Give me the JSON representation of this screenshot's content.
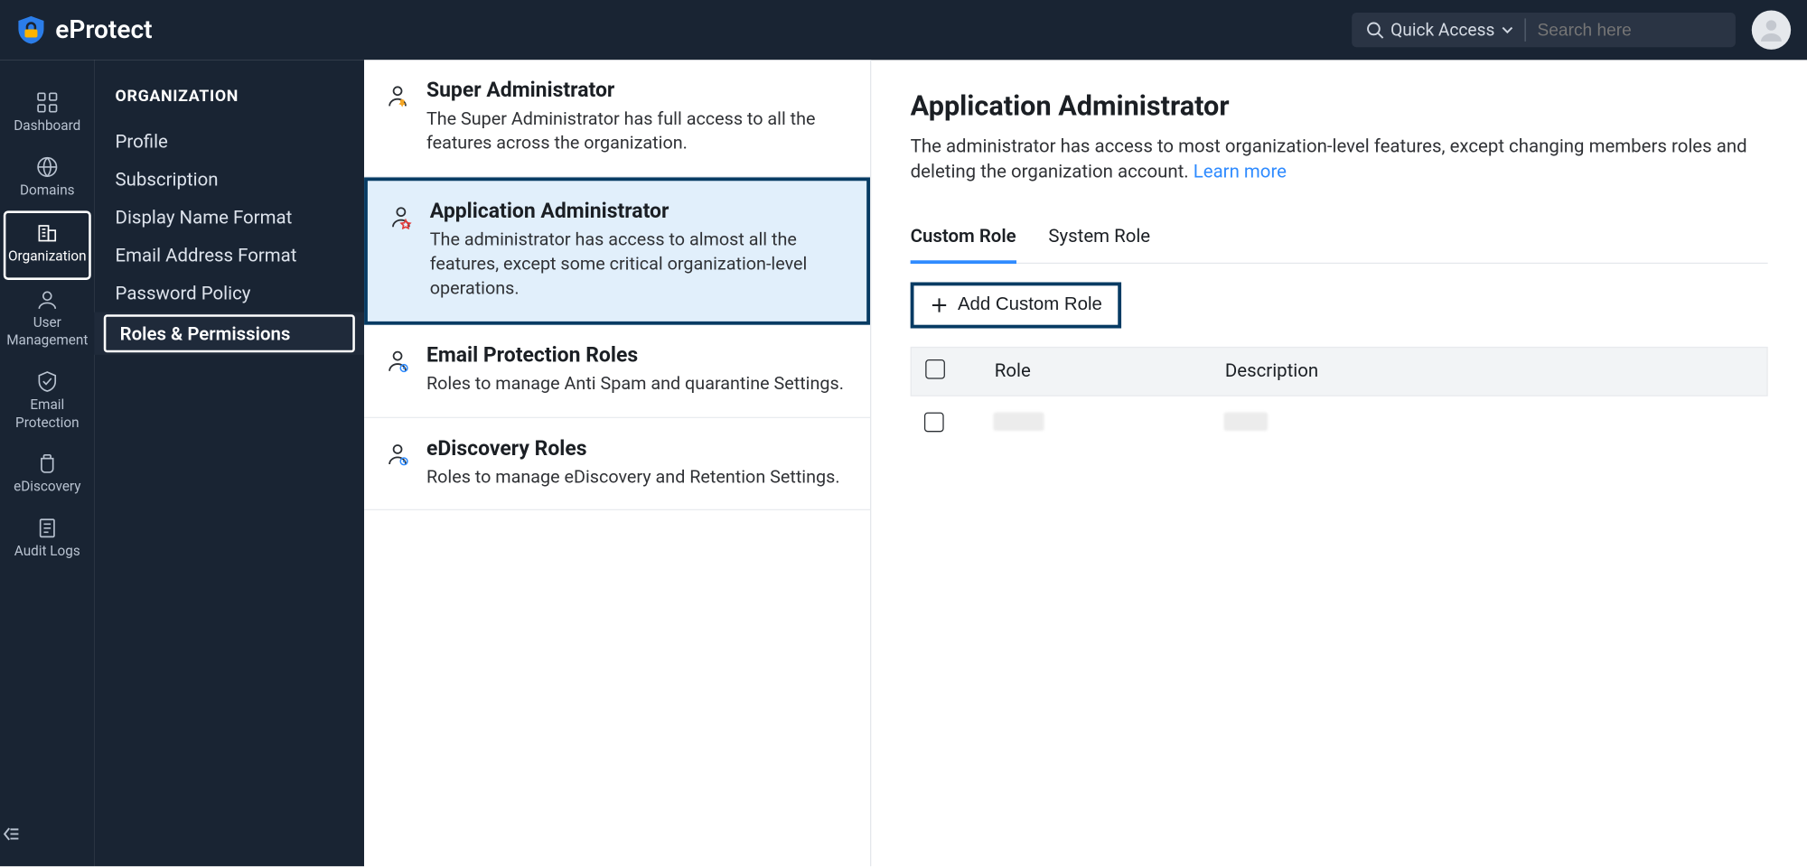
{
  "header": {
    "brand": "eProtect",
    "quick_access_label": "Quick Access",
    "search_placeholder": "Search here"
  },
  "nav": {
    "items": [
      {
        "label": "Dashboard"
      },
      {
        "label": "Domains"
      },
      {
        "label": "Organization"
      },
      {
        "label": "User Management"
      },
      {
        "label": "Email Protection"
      },
      {
        "label": "eDiscovery"
      },
      {
        "label": "Audit Logs"
      }
    ]
  },
  "subnav": {
    "title": "ORGANIZATION",
    "items": [
      {
        "label": "Profile"
      },
      {
        "label": "Subscription"
      },
      {
        "label": "Display Name Format"
      },
      {
        "label": "Email Address Format"
      },
      {
        "label": "Password Policy"
      },
      {
        "label": "Roles & Permissions"
      }
    ]
  },
  "roles_list": [
    {
      "title": "Super Administrator",
      "desc": "The Super Administrator has full access to all the features across the organization."
    },
    {
      "title": "Application Administrator",
      "desc": "The administrator has access to almost all the features, except some critical organization-level operations."
    },
    {
      "title": "Email Protection Roles",
      "desc": "Roles to manage Anti Spam and quarantine Settings."
    },
    {
      "title": "eDiscovery Roles",
      "desc": "Roles to manage eDiscovery and Retention Settings."
    }
  ],
  "details": {
    "title": "Application Administrator",
    "desc": "The administrator has access to most organization-level features, except changing members roles and deleting the organization account. ",
    "learn_more": "Learn more",
    "tabs": {
      "custom": "Custom Role",
      "system": "System Role"
    },
    "add_btn": "Add Custom Role",
    "table": {
      "col_role": "Role",
      "col_desc": "Description"
    }
  }
}
